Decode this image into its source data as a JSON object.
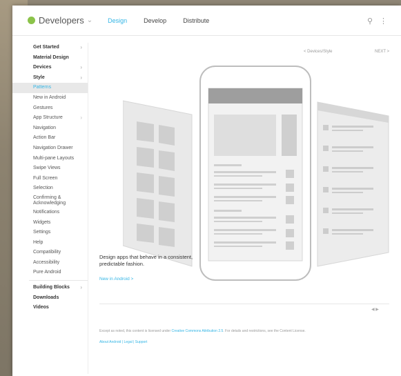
{
  "header": {
    "logo_text": "Developers",
    "nav": [
      "Design",
      "Develop",
      "Distribute"
    ],
    "active_nav": "Design",
    "search_icon": "search-icon",
    "menu_icon": "more-vert-icon"
  },
  "sidebar": {
    "items": [
      {
        "label": "Get Started",
        "bold": true,
        "arrow": true
      },
      {
        "label": "Material Design",
        "bold": true,
        "arrow": false
      },
      {
        "label": "Devices",
        "bold": true,
        "arrow": true
      },
      {
        "label": "Style",
        "bold": true,
        "arrow": true
      },
      {
        "label": "Patterns",
        "bold": false,
        "active": true
      },
      {
        "label": "New in Android",
        "bold": false
      },
      {
        "label": "Gestures",
        "bold": false
      },
      {
        "label": "App Structure",
        "bold": false,
        "arrow": true
      },
      {
        "label": "Navigation",
        "bold": false
      },
      {
        "label": "Action Bar",
        "bold": false
      },
      {
        "label": "Navigation Drawer",
        "bold": false
      },
      {
        "label": "Multi-pane Layouts",
        "bold": false
      },
      {
        "label": "Swipe Views",
        "bold": false
      },
      {
        "label": "Full Screen",
        "bold": false
      },
      {
        "label": "Selection",
        "bold": false
      },
      {
        "label": "Confirming & Acknowledging",
        "bold": false,
        "two_line": true
      },
      {
        "label": "Notifications",
        "bold": false
      },
      {
        "label": "Widgets",
        "bold": false
      },
      {
        "label": "Settings",
        "bold": false
      },
      {
        "label": "Help",
        "bold": false
      },
      {
        "label": "Compatibility",
        "bold": false
      },
      {
        "label": "Accessibility",
        "bold": false
      },
      {
        "label": "Pure Android",
        "bold": false
      }
    ],
    "bottom_items": [
      {
        "label": "Building Blocks",
        "bold": true,
        "arrow": true
      },
      {
        "label": "Downloads",
        "bold": true
      },
      {
        "label": "Videos",
        "bold": true
      }
    ]
  },
  "main": {
    "crumb_left": "< Devices/Style",
    "crumb_right": "NEXT >",
    "caption": "Design apps that behave in a consistent, predictable fashion.",
    "caption_link": "New in Android >",
    "pager": "◀ ▶",
    "footer_text_a": "Except as noted, this content is licensed under ",
    "footer_text_link": "Creative Commons Attribution 2.5",
    "footer_text_b": ". For details and restrictions, see the Content License.",
    "footer_links": "About Android | Legal | Support"
  },
  "colors": {
    "accent": "#33b5e5",
    "android_green": "#8bc34a",
    "text": "#444444"
  }
}
